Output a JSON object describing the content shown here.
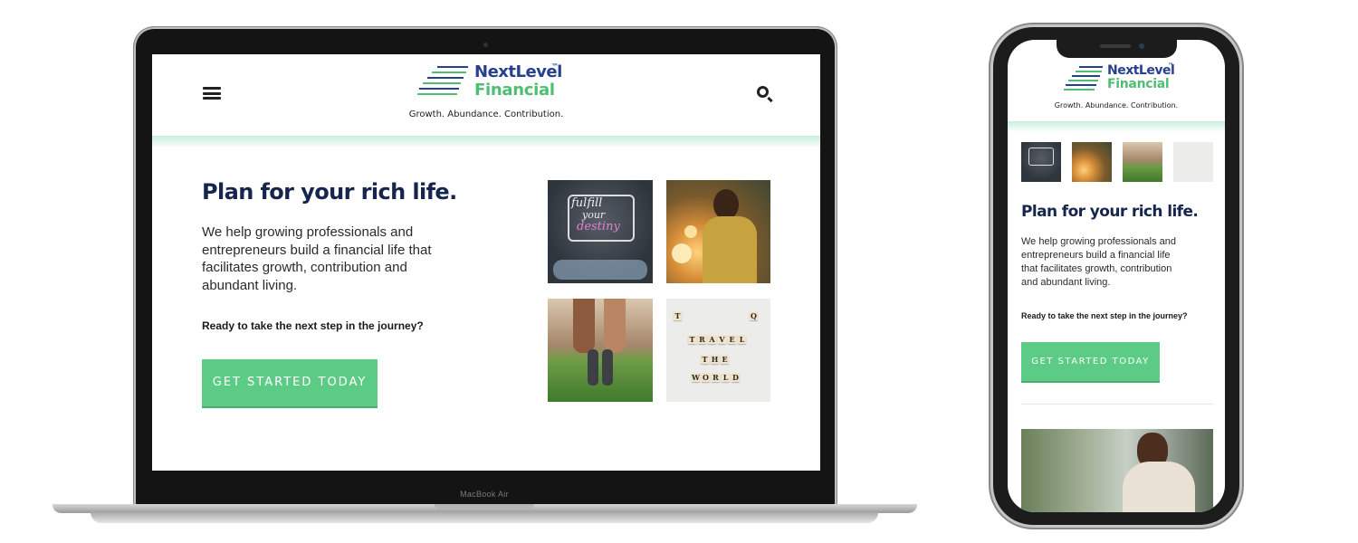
{
  "brand": {
    "name_line1": "NextLevel",
    "trademark": "™",
    "name_line2": "Financial",
    "tagline": "Growth. Abundance. Contribution."
  },
  "hero": {
    "headline": "Plan for your rich life.",
    "desktop_body": [
      "We help growing professionals and",
      "entrepreneurs build a financial life that",
      "facilitates growth, contribution and",
      "abundant living."
    ],
    "mobile_body": [
      "We help growing professionals and",
      "entrepreneurs build a financial life",
      "that facilitates growth, contribution",
      "and abundant living."
    ],
    "prompt": "Ready to take the next step in the journey?",
    "cta_label": "GET STARTED TODAY"
  },
  "photos": {
    "chalk_text": [
      "fulfill",
      "your",
      "destiny"
    ],
    "scrabble_words": [
      "TRAVEL",
      "THE",
      "WORLD"
    ]
  },
  "device": {
    "laptop_label": "MacBook Air"
  },
  "icons": {
    "menu": "hamburger-menu-icon",
    "search": "search-icon"
  },
  "colors": {
    "brand_navy": "#26408f",
    "brand_green": "#4fbe72",
    "headline": "#16254d",
    "cta": "#5ccb85"
  }
}
